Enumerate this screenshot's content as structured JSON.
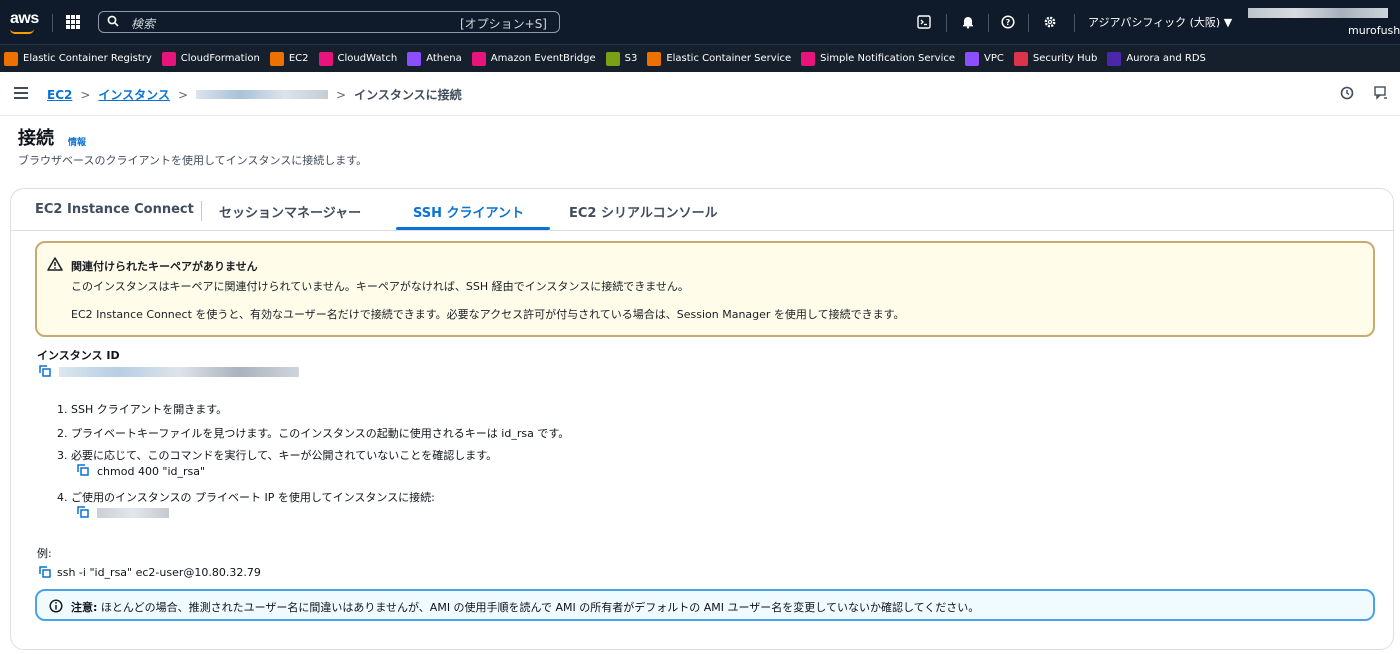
{
  "topnav": {
    "logo": "aws",
    "search_placeholder": "検索",
    "search_shortcut": "[オプション+S]",
    "region": "アジアパシフィック (大阪) ▼",
    "account_name": "murofush"
  },
  "favorites": [
    {
      "label": "Elastic Container Registry",
      "color": "#ed7100",
      "icon": "container-registry-icon"
    },
    {
      "label": "CloudFormation",
      "color": "#e7157b",
      "icon": "cloudformation-icon"
    },
    {
      "label": "EC2",
      "color": "#ed7100",
      "icon": "ec2-icon"
    },
    {
      "label": "CloudWatch",
      "color": "#e7157b",
      "icon": "cloudwatch-icon"
    },
    {
      "label": "Athena",
      "color": "#8c4fff",
      "icon": "athena-icon"
    },
    {
      "label": "Amazon EventBridge",
      "color": "#e7157b",
      "icon": "eventbridge-icon"
    },
    {
      "label": "S3",
      "color": "#7aa116",
      "icon": "s3-icon"
    },
    {
      "label": "Elastic Container Service",
      "color": "#ed7100",
      "icon": "ecs-icon"
    },
    {
      "label": "Simple Notification Service",
      "color": "#e7157b",
      "icon": "sns-icon"
    },
    {
      "label": "VPC",
      "color": "#8c4fff",
      "icon": "vpc-icon"
    },
    {
      "label": "Security Hub",
      "color": "#dd344c",
      "icon": "security-hub-icon"
    },
    {
      "label": "Aurora and RDS",
      "color": "#4d27aa",
      "icon": "rds-icon"
    }
  ],
  "breadcrumb": {
    "item1": "EC2",
    "item2": "インスタンス",
    "current": "インスタンスに接続",
    "sep": ">"
  },
  "page": {
    "title": "接続",
    "info": "情報",
    "description": "ブラウザベースのクライアントを使用してインスタンスに接続します。"
  },
  "tabs": {
    "t1": "EC2 Instance Connect",
    "t2": "セッションマネージャー",
    "t3": "SSH クライアント",
    "t4": "EC2 シリアルコンソール"
  },
  "warning": {
    "title": "関連付けられたキーペアがありません",
    "line1": "このインスタンスはキーペアに関連付けられていません。キーペアがなければ、SSH 経由でインスタンスに接続できません。",
    "line2": "EC2 Instance Connect を使うと、有効なユーザー名だけで接続できます。必要なアクセス許可が付与されている場合は、Session Manager を使用して接続できます。",
    "color": "#8d6605"
  },
  "instance": {
    "label": "インスタンス ID"
  },
  "steps": {
    "s1": "1. SSH クライアントを開きます。",
    "s2": "2. プライベートキーファイルを見つけます。このインスタンスの起動に使用されるキーは id_rsa です。",
    "s3": "3. 必要に応じて、このコマンドを実行して、キーが公開されていないことを確認します。",
    "s3_code": "chmod 400 \"id_rsa\"",
    "s4": "4. ご使用のインスタンスの プライベート IP を使用してインスタンスに接続:"
  },
  "example": {
    "label": "例:",
    "command": "ssh -i \"id_rsa\" ec2-user@10.80.32.79"
  },
  "note": {
    "bold": "注意:",
    "text": " ほとんどの場合、推測されたユーザー名に間違いはありませんが、AMI の使用手順を読んで AMI の所有者がデフォルトの AMI ユーザー名を変更していないか確認してください。"
  },
  "colors": {
    "nav_bg": "#0f1b2a",
    "link": "#0972d3",
    "info_border": "#4aa3e8"
  }
}
